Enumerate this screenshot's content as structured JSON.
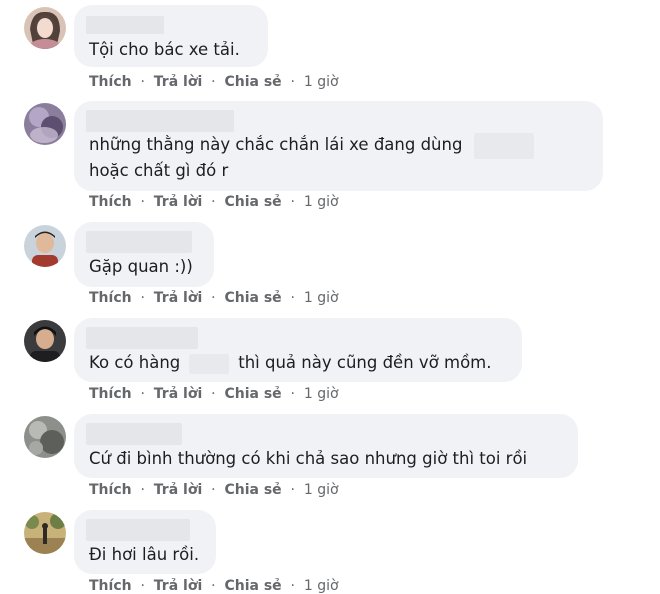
{
  "actions": {
    "like": "Thích",
    "reply": "Trả lời",
    "share": "Chia sẻ",
    "time": "1 giờ",
    "sep": "·"
  },
  "comments": [
    {
      "line1": "Tội cho bác xe tải."
    },
    {
      "line1": "những thằng này chắc chắn lái xe đang dùng",
      "line2": "hoặc chất gì đó r"
    },
    {
      "line1": "Gặp quan :))"
    },
    {
      "line1_a": "Ko có hàng",
      "line1_b": "thì quả này cũng đền vỡ mồm."
    },
    {
      "line1": "Cứ đi bình thường có khi chả sao nhưng giờ thì toi rồi"
    },
    {
      "line1": "Đi hơi lâu rồi."
    }
  ]
}
